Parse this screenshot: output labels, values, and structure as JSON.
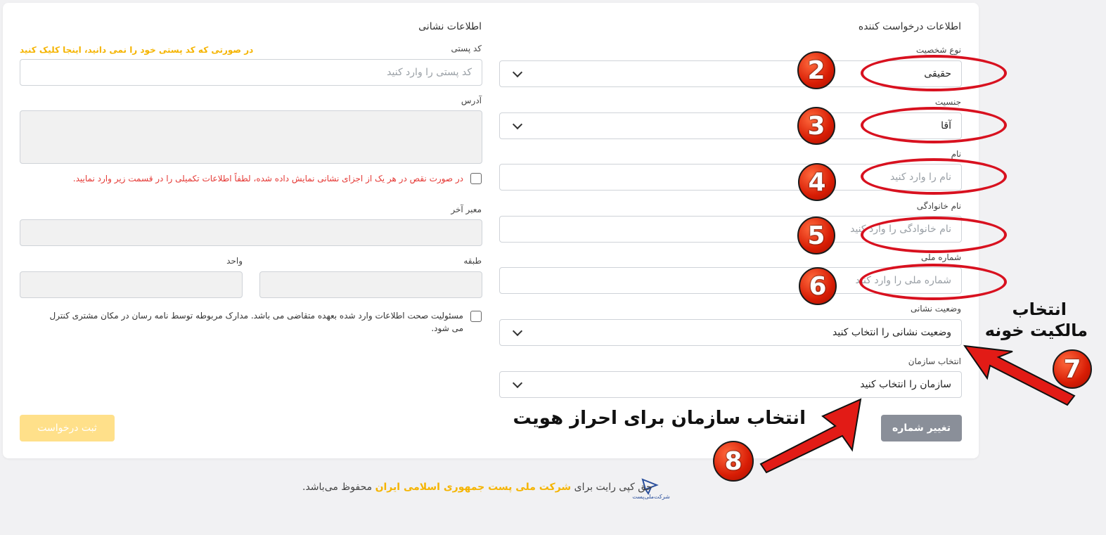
{
  "right_section": {
    "title": "اطلاعات درخواست کننده",
    "person_type": {
      "label": "نوع شخصیت",
      "value": "حقیقی"
    },
    "gender": {
      "label": "جنسیت",
      "value": "آقا"
    },
    "first_name": {
      "label": "نام",
      "placeholder": "نام را وارد کنید"
    },
    "last_name": {
      "label": "نام خانوادگی",
      "placeholder": "نام خانوادگی را وارد کنید"
    },
    "national_id": {
      "label": "شماره ملی",
      "placeholder": "شماره ملی را وارد کنید"
    },
    "address_status": {
      "label": "وضعیت نشانی",
      "value": "وضعیت نشانی را انتخاب کنید"
    },
    "organization": {
      "label": "انتخاب سازمان",
      "value": "سازمان را انتخاب کنید"
    },
    "change_number_button": "تغییر شماره"
  },
  "left_section": {
    "title": "اطلاعات نشانی",
    "postal_code": {
      "label": "کد پستی",
      "placeholder": "کد پستی را وارد کنید",
      "help_link": "در صورتی که کد پستی خود را نمی دانید، اینجا کلیک کنید"
    },
    "address": {
      "label": "آدرس",
      "value": ""
    },
    "incomplete_note": "در صورت نقص در هر یک از اجزای نشانی نمایش داده شده، لطفاً اطلاعات تکمیلی را در قسمت زیر وارد نمایید.",
    "last_passage": {
      "label": "معبر آخر",
      "value": ""
    },
    "floor": {
      "label": "طبقه",
      "value": ""
    },
    "unit": {
      "label": "واحد",
      "value": ""
    },
    "responsibility_note_line1": "مسئولیت صحت اطلاعات وارد شده بعهده متقاضی می باشد. مدارک مربوطه توسط نامه رسان در مکان مشتری کنترل",
    "responsibility_note_line2": "می شود.",
    "submit_button": "ثبت درخواست"
  },
  "annotations": {
    "badges": [
      "2",
      "3",
      "4",
      "5",
      "6",
      "7",
      "8"
    ],
    "label_7_line1": "انتخاب",
    "label_7_line2": "مالکیت خونه",
    "label_8": "انتخاب سازمان برای احراز هویت",
    "color": "#d8111f"
  },
  "footer": {
    "logo_text": "شرکت‌ملی‌پست",
    "prefix": "حق کپی رایت برای",
    "company": "شرکت ملی پست جمهوری اسلامی ایران",
    "suffix": "محفوظ می‌باشد."
  },
  "colors": {
    "accent_yellow": "#f5b400",
    "error_red": "#e53935",
    "button_gray": "#8a8f99",
    "submit_disabled": "#ffe08a"
  }
}
